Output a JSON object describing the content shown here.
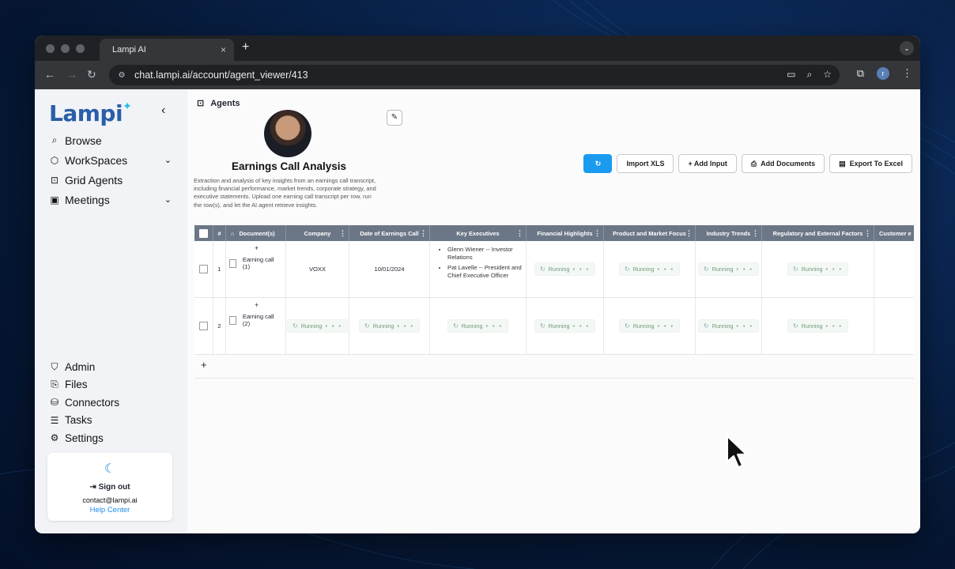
{
  "browser": {
    "tab_title": "Lampi AI",
    "tab_close": "×",
    "new_tab": "+",
    "tab_menu": "⌄",
    "url": "chat.lampi.ai/account/agent_viewer/413",
    "profile_initial": "r"
  },
  "sidebar": {
    "logo": "Lampi",
    "collapse": "‹",
    "top_items": [
      {
        "label": "Browse",
        "icon": "search-icon"
      },
      {
        "label": "WorkSpaces",
        "icon": "cube-icon"
      },
      {
        "label": "Grid Agents",
        "icon": "robot-icon"
      },
      {
        "label": "Meetings",
        "icon": "video-icon"
      }
    ],
    "bottom_items": [
      {
        "label": "Admin",
        "icon": "shield-icon"
      },
      {
        "label": "Files",
        "icon": "file-plus-icon"
      },
      {
        "label": "Connectors",
        "icon": "database-icon"
      },
      {
        "label": "Tasks",
        "icon": "checklist-icon"
      },
      {
        "label": "Settings",
        "icon": "gear-icon"
      }
    ],
    "account": {
      "sign_out": "Sign out",
      "email": "contact@lampi.ai",
      "help": "Help Center"
    }
  },
  "main": {
    "section": "Agents",
    "agent_title": "Earnings Call Analysis",
    "agent_description": "Extraction and analysis of key insights from an earnings call transcript, including financial performance, market trends, corporate strategy, and executive statements. Upload one earning call transcript per row, run the row(s), and let the AI agent retrieve insights.",
    "buttons": {
      "import": "Import XLS",
      "add_input": "+ Add Input",
      "add_documents": "Add Documents",
      "export": "Export To Excel"
    }
  },
  "grid": {
    "columns": [
      "#",
      "Document(s)",
      "Company",
      "Date of Earnings Call",
      "Key Executives",
      "Financial Highlights",
      "Product and Market Focus",
      "Industry Trends",
      "Regulatory and External Factors",
      "Customer e"
    ],
    "running_label": "Running",
    "running_dots": "• • •",
    "rows": [
      {
        "num": "1",
        "plus": "+",
        "document": "Earning call (1)",
        "company": "VOXX",
        "date": "10/01/2024",
        "executives": [
          "Glenn Wiener -- Investor Relations",
          "Pat Lavelle -- President and Chief Executive Officer"
        ]
      },
      {
        "num": "2",
        "plus": "+",
        "document": "Earning call (2)"
      }
    ],
    "add_row": "+"
  }
}
